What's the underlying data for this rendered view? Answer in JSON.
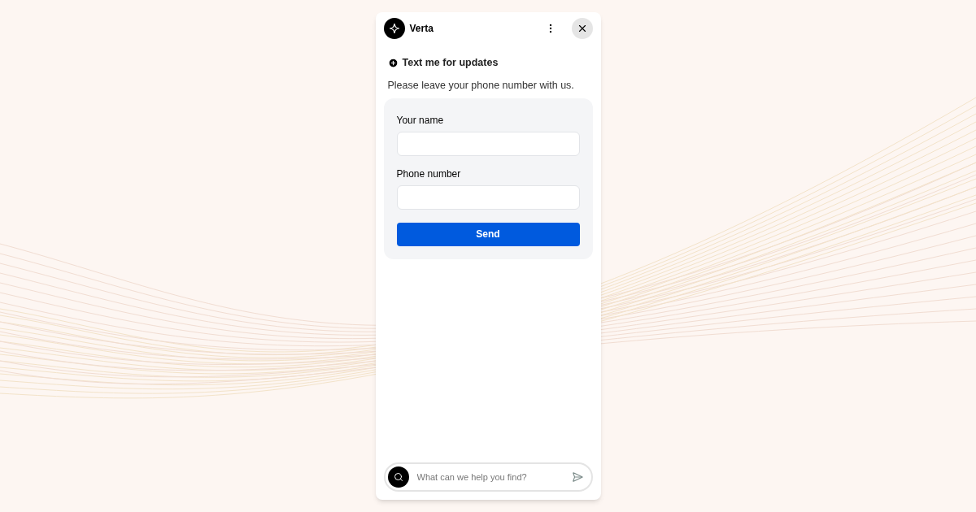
{
  "header": {
    "title": "Verta"
  },
  "section": {
    "title": "Text me for updates",
    "description": "Please leave your phone number with us."
  },
  "form": {
    "fields": [
      {
        "label": "Your name"
      },
      {
        "label": "Phone number"
      }
    ],
    "submit": "Send"
  },
  "chat_input": {
    "placeholder": "What can we help you find?"
  }
}
